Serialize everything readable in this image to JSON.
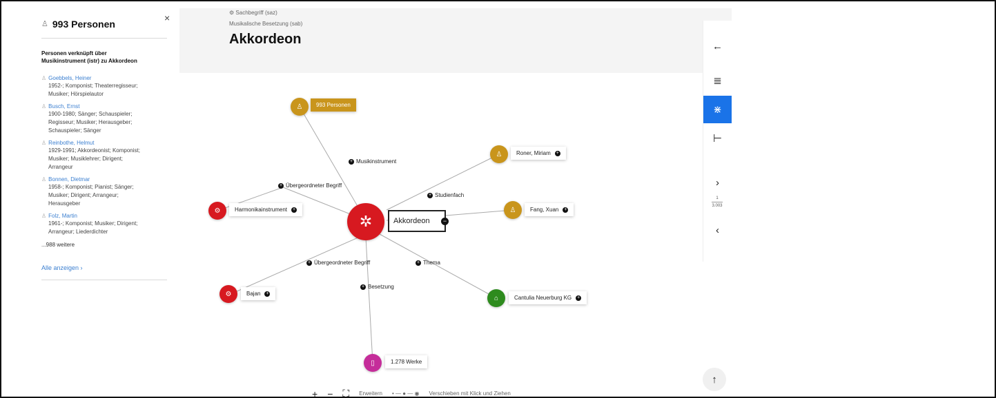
{
  "left_panel": {
    "title": "993 Personen",
    "close": "×",
    "subtitle_line1": "Personen verknüpft über",
    "subtitle_line2": "Musikinstrument (istr) zu Akkordeon",
    "persons": [
      {
        "name": "Goebbels, Heiner",
        "desc": [
          "1952-; Komponist; Theaterregisseur;",
          "Musiker; Hörspielautor"
        ]
      },
      {
        "name": "Busch, Ernst",
        "desc": [
          "1900-1980; Sänger; Schauspieler;",
          "Regisseur; Musiker; Herausgeber;",
          "Schauspieler; Sänger"
        ]
      },
      {
        "name": "Reinbothe, Helmut",
        "desc": [
          "1929-1991; Akkordeonist; Komponist;",
          "Musiker; Musiklehrer; Dirigent;",
          "Arrangeur"
        ]
      },
      {
        "name": "Bonnen, Dietmar",
        "desc": [
          "1958-; Komponist; Pianist; Sänger;",
          "Musiker; Dirigent; Arrangeur;",
          "Herausgeber"
        ]
      },
      {
        "name": "Folz, Martin",
        "desc": [
          "1961-; Komponist; Musiker; Dirigent;",
          "Arrangeur; Liederdichter"
        ]
      }
    ],
    "more": "...988 weitere",
    "show_all": "Alle anzeigen ›"
  },
  "header": {
    "crumb1": "Sachbegriff (saz)",
    "crumb2": "Musikalische Besetzung (sab)",
    "title": "Akkordeon"
  },
  "graph": {
    "center": "Akkordeon",
    "nodes": {
      "personen": "993 Personen",
      "roner": "Roner, Miriam",
      "fang": "Fang, Xuan",
      "harmonika": "Harmonikainstrument",
      "bajan": "Bajan",
      "cantulia": "Cantulia Neuerburg KG",
      "werke": "1.278 Werke"
    },
    "edges": {
      "musikinstrument": "Musikinstrument",
      "uebergeordnet1": "Übergeordneter Begriff",
      "studienfach": "Studienfach",
      "uebergeordnet2": "Übergeordneter Begriff",
      "thema": "Thema",
      "besetzung": "Besetzung"
    },
    "colors": {
      "red": "#d71920",
      "gold": "#c9951c",
      "green": "#2e8b1e",
      "magenta": "#c52d9a"
    }
  },
  "toolbar": {
    "back": "←",
    "list": "≣",
    "network": "⋇",
    "tree": "⊢",
    "next": "›",
    "page": "1",
    "total": "3.003",
    "prev": "‹",
    "top": "↑"
  },
  "controls": {
    "zoom_in": "+",
    "zoom_out": "−",
    "fit": "⛶",
    "expand": "Erweitern",
    "move": "Verschieben mit Klick und Ziehen"
  }
}
